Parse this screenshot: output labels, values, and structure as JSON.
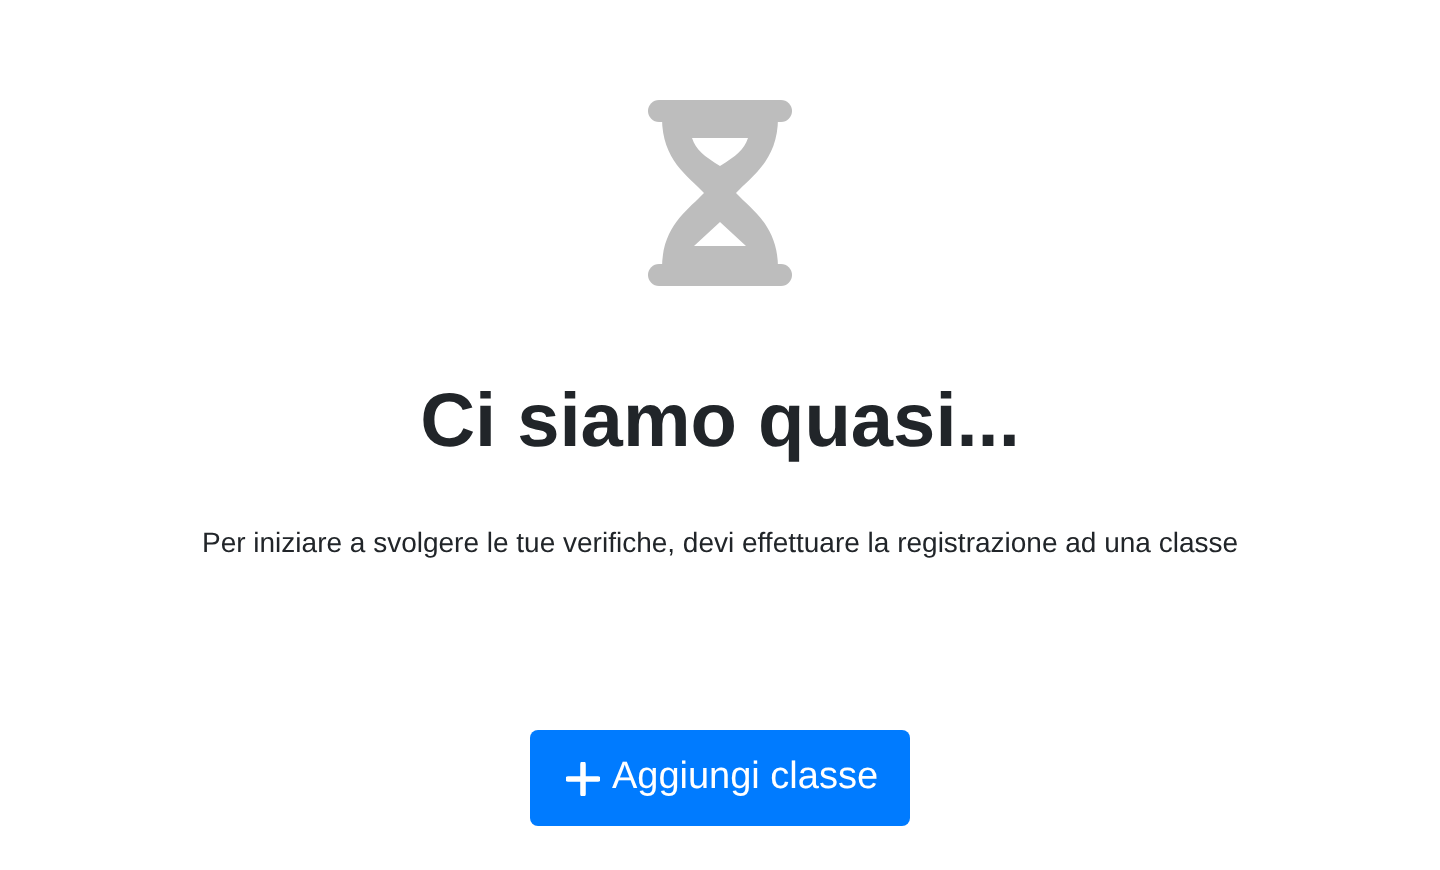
{
  "title": "Ci siamo quasi...",
  "message": "Per iniziare a svolgere le tue verifiche, devi effettuare la registrazione ad una classe",
  "button": {
    "label": "Aggiungi classe"
  }
}
